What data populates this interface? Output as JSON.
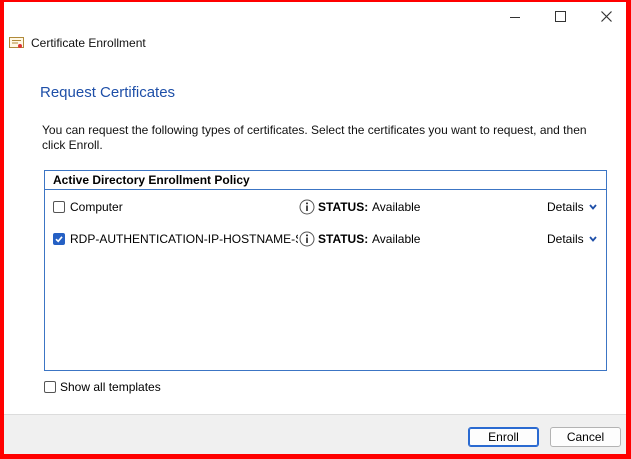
{
  "window": {
    "title": "Certificate Enrollment",
    "caption_icons": [
      "minimize-icon",
      "maximize-icon",
      "close-icon"
    ]
  },
  "page": {
    "heading": "Request Certificates",
    "description": "You can request the following types of certificates. Select the certificates you want to request, and then click Enroll."
  },
  "policy": {
    "header": "Active Directory Enrollment Policy",
    "items": [
      {
        "name": "Computer",
        "checked": false,
        "status_label": "STATUS:",
        "status_value": "Available",
        "details_label": "Details"
      },
      {
        "name": "RDP-AUTHENTICATION-IP-HOSTNAME-SS",
        "checked": true,
        "status_label": "STATUS:",
        "status_value": "Available",
        "details_label": "Details"
      }
    ]
  },
  "options": {
    "show_all_label": "Show all templates",
    "show_all_checked": false
  },
  "footer": {
    "enroll_label": "Enroll",
    "cancel_label": "Cancel"
  },
  "colors": {
    "frame": "#ff0000",
    "heading": "#1e4fa8",
    "accent": "#2560c4",
    "border": "#3c75c4"
  }
}
